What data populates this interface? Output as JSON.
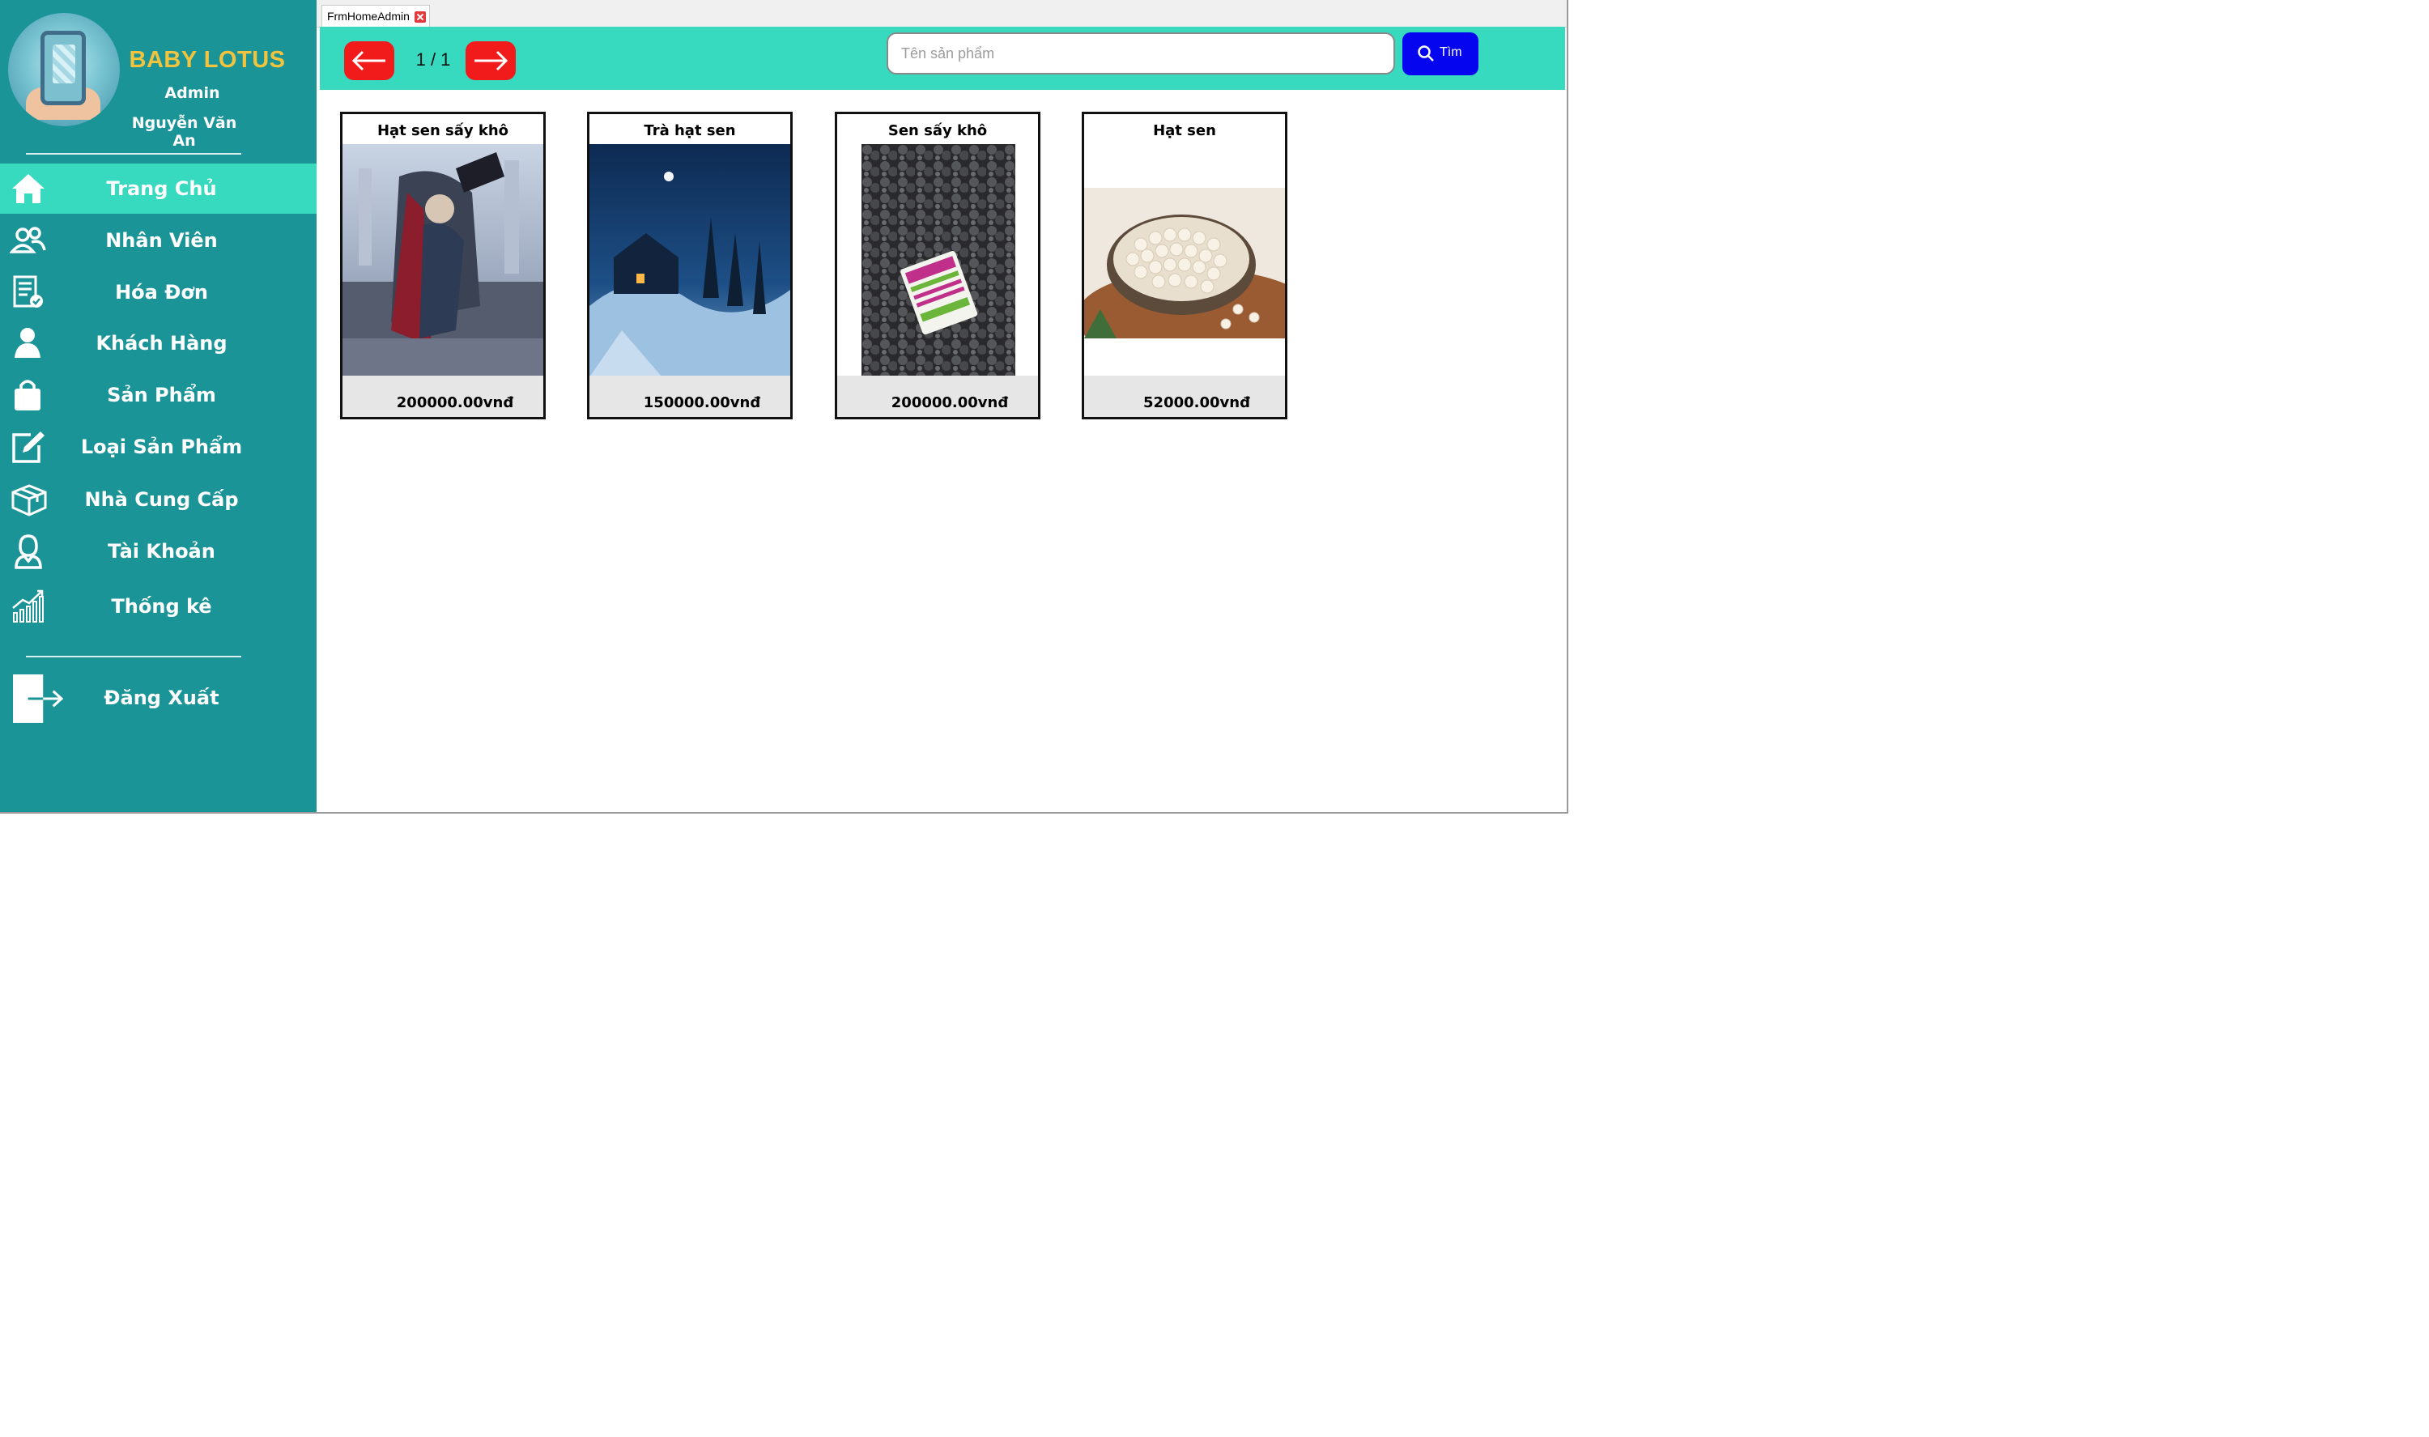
{
  "window": {
    "tab_title": "FrmHomeAdmin"
  },
  "sidebar": {
    "brand": "BABY LOTUS",
    "role": "Admin",
    "username": "Nguyễn Văn An",
    "items": [
      {
        "label": "Trang Chủ",
        "icon": "home-icon",
        "active": true
      },
      {
        "label": "Nhân Viên",
        "icon": "users-icon"
      },
      {
        "label": "Hóa Đơn",
        "icon": "invoice-icon"
      },
      {
        "label": "Khách Hàng",
        "icon": "customer-icon"
      },
      {
        "label": "Sản Phẩm",
        "icon": "shopping-bag-icon"
      },
      {
        "label": "Loại Sản Phẩm",
        "icon": "edit-icon"
      },
      {
        "label": "Nhà Cung Cấp",
        "icon": "box-icon"
      },
      {
        "label": "Tài Khoản",
        "icon": "account-icon"
      },
      {
        "label": "Thống kê",
        "icon": "chart-icon"
      }
    ],
    "logout": {
      "label": "Đăng Xuất",
      "icon": "logout-icon"
    }
  },
  "toolbar": {
    "page_indicator": "1 / 1",
    "search_placeholder": "Tên sản phẩm",
    "search_value": "",
    "search_label": "Tìm"
  },
  "products": [
    {
      "name": "Hạt sen sấy khô",
      "price": "200000.00vnđ"
    },
    {
      "name": "Trà hạt sen",
      "price": "150000.00vnđ"
    },
    {
      "name": "Sen sấy khô",
      "price": "200000.00vnđ"
    },
    {
      "name": "Hạt sen",
      "price": "52000.00vnđ"
    }
  ],
  "colors": {
    "sidebar_bg": "#1b9498",
    "accent": "#37d9bf",
    "brand_text": "#f2c33d",
    "nav_button": "#f21b1b",
    "search_button": "#0505f0"
  }
}
